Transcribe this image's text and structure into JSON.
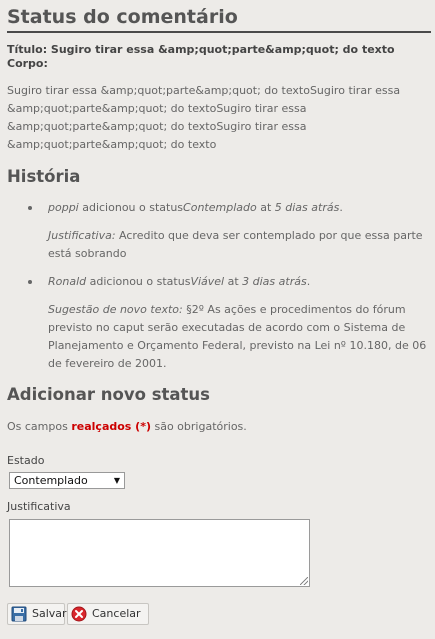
{
  "page": {
    "title": "Status do comentário",
    "titulo_line": "Título: Sugiro tirar essa &amp;quot;parte&amp;quot; do texto",
    "corpo_label": "Corpo:",
    "corpo_text": "Sugiro tirar essa &amp;quot;parte&amp;quot; do textoSugiro tirar essa &amp;quot;parte&amp;quot; do textoSugiro tirar essa &amp;quot;parte&amp;quot; do textoSugiro tirar essa &amp;quot;parte&amp;quot; do texto"
  },
  "history": {
    "title": "História",
    "items": [
      {
        "user": "poppi",
        "action": " adicionou o status",
        "status": "Contemplado",
        "at": " at ",
        "when": "5 dias atrás",
        "dot": ".",
        "just_label": "Justificativa:",
        "just_text": " Acredito que deva ser contemplado por que essa parte está sobrando"
      },
      {
        "user": "Ronald",
        "action": " adicionou o status",
        "status": "Viável",
        "at": " at ",
        "when": "3 dias atrás",
        "dot": ".",
        "just_label": "Sugestão de novo texto:",
        "just_text": " §2º As ações e procedimentos do fórum previsto no caput serão executadas de acordo com o Sistema de Planejamento e Orçamento Federal, previsto na Lei nº 10.180, de 06 de fevereiro de 2001."
      }
    ]
  },
  "form": {
    "title": "Adicionar novo status",
    "required_prefix": "Os campos ",
    "required_highlight": "realçados (*)",
    "required_suffix": " são obrigatórios.",
    "estado_label": "Estado",
    "estado_value": "Contemplado",
    "justificativa_label": "Justificativa",
    "justificativa_value": "",
    "save_label": "Salvar",
    "cancel_label": "Cancelar"
  },
  "icons": {
    "save": "save-disk-icon",
    "cancel": "cancel-x-icon"
  },
  "colors": {
    "background": "#edebe8",
    "required_highlight": "#cc0000",
    "cancel_icon": "#d9262c"
  }
}
